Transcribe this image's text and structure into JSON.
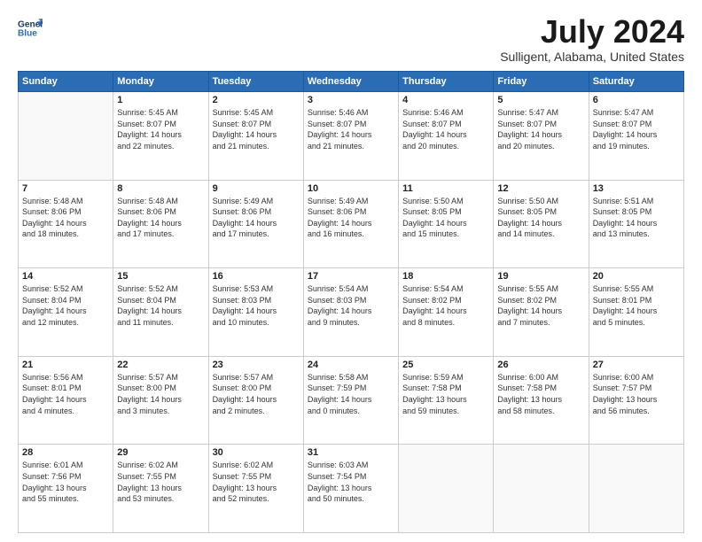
{
  "header": {
    "logo_line1": "General",
    "logo_line2": "Blue",
    "month": "July 2024",
    "location": "Sulligent, Alabama, United States"
  },
  "days_of_week": [
    "Sunday",
    "Monday",
    "Tuesday",
    "Wednesday",
    "Thursday",
    "Friday",
    "Saturday"
  ],
  "weeks": [
    [
      {
        "day": "",
        "info": ""
      },
      {
        "day": "1",
        "info": "Sunrise: 5:45 AM\nSunset: 8:07 PM\nDaylight: 14 hours\nand 22 minutes."
      },
      {
        "day": "2",
        "info": "Sunrise: 5:45 AM\nSunset: 8:07 PM\nDaylight: 14 hours\nand 21 minutes."
      },
      {
        "day": "3",
        "info": "Sunrise: 5:46 AM\nSunset: 8:07 PM\nDaylight: 14 hours\nand 21 minutes."
      },
      {
        "day": "4",
        "info": "Sunrise: 5:46 AM\nSunset: 8:07 PM\nDaylight: 14 hours\nand 20 minutes."
      },
      {
        "day": "5",
        "info": "Sunrise: 5:47 AM\nSunset: 8:07 PM\nDaylight: 14 hours\nand 20 minutes."
      },
      {
        "day": "6",
        "info": "Sunrise: 5:47 AM\nSunset: 8:07 PM\nDaylight: 14 hours\nand 19 minutes."
      }
    ],
    [
      {
        "day": "7",
        "info": "Sunrise: 5:48 AM\nSunset: 8:06 PM\nDaylight: 14 hours\nand 18 minutes."
      },
      {
        "day": "8",
        "info": "Sunrise: 5:48 AM\nSunset: 8:06 PM\nDaylight: 14 hours\nand 17 minutes."
      },
      {
        "day": "9",
        "info": "Sunrise: 5:49 AM\nSunset: 8:06 PM\nDaylight: 14 hours\nand 17 minutes."
      },
      {
        "day": "10",
        "info": "Sunrise: 5:49 AM\nSunset: 8:06 PM\nDaylight: 14 hours\nand 16 minutes."
      },
      {
        "day": "11",
        "info": "Sunrise: 5:50 AM\nSunset: 8:05 PM\nDaylight: 14 hours\nand 15 minutes."
      },
      {
        "day": "12",
        "info": "Sunrise: 5:50 AM\nSunset: 8:05 PM\nDaylight: 14 hours\nand 14 minutes."
      },
      {
        "day": "13",
        "info": "Sunrise: 5:51 AM\nSunset: 8:05 PM\nDaylight: 14 hours\nand 13 minutes."
      }
    ],
    [
      {
        "day": "14",
        "info": "Sunrise: 5:52 AM\nSunset: 8:04 PM\nDaylight: 14 hours\nand 12 minutes."
      },
      {
        "day": "15",
        "info": "Sunrise: 5:52 AM\nSunset: 8:04 PM\nDaylight: 14 hours\nand 11 minutes."
      },
      {
        "day": "16",
        "info": "Sunrise: 5:53 AM\nSunset: 8:03 PM\nDaylight: 14 hours\nand 10 minutes."
      },
      {
        "day": "17",
        "info": "Sunrise: 5:54 AM\nSunset: 8:03 PM\nDaylight: 14 hours\nand 9 minutes."
      },
      {
        "day": "18",
        "info": "Sunrise: 5:54 AM\nSunset: 8:02 PM\nDaylight: 14 hours\nand 8 minutes."
      },
      {
        "day": "19",
        "info": "Sunrise: 5:55 AM\nSunset: 8:02 PM\nDaylight: 14 hours\nand 7 minutes."
      },
      {
        "day": "20",
        "info": "Sunrise: 5:55 AM\nSunset: 8:01 PM\nDaylight: 14 hours\nand 5 minutes."
      }
    ],
    [
      {
        "day": "21",
        "info": "Sunrise: 5:56 AM\nSunset: 8:01 PM\nDaylight: 14 hours\nand 4 minutes."
      },
      {
        "day": "22",
        "info": "Sunrise: 5:57 AM\nSunset: 8:00 PM\nDaylight: 14 hours\nand 3 minutes."
      },
      {
        "day": "23",
        "info": "Sunrise: 5:57 AM\nSunset: 8:00 PM\nDaylight: 14 hours\nand 2 minutes."
      },
      {
        "day": "24",
        "info": "Sunrise: 5:58 AM\nSunset: 7:59 PM\nDaylight: 14 hours\nand 0 minutes."
      },
      {
        "day": "25",
        "info": "Sunrise: 5:59 AM\nSunset: 7:58 PM\nDaylight: 13 hours\nand 59 minutes."
      },
      {
        "day": "26",
        "info": "Sunrise: 6:00 AM\nSunset: 7:58 PM\nDaylight: 13 hours\nand 58 minutes."
      },
      {
        "day": "27",
        "info": "Sunrise: 6:00 AM\nSunset: 7:57 PM\nDaylight: 13 hours\nand 56 minutes."
      }
    ],
    [
      {
        "day": "28",
        "info": "Sunrise: 6:01 AM\nSunset: 7:56 PM\nDaylight: 13 hours\nand 55 minutes."
      },
      {
        "day": "29",
        "info": "Sunrise: 6:02 AM\nSunset: 7:55 PM\nDaylight: 13 hours\nand 53 minutes."
      },
      {
        "day": "30",
        "info": "Sunrise: 6:02 AM\nSunset: 7:55 PM\nDaylight: 13 hours\nand 52 minutes."
      },
      {
        "day": "31",
        "info": "Sunrise: 6:03 AM\nSunset: 7:54 PM\nDaylight: 13 hours\nand 50 minutes."
      },
      {
        "day": "",
        "info": ""
      },
      {
        "day": "",
        "info": ""
      },
      {
        "day": "",
        "info": ""
      }
    ]
  ]
}
